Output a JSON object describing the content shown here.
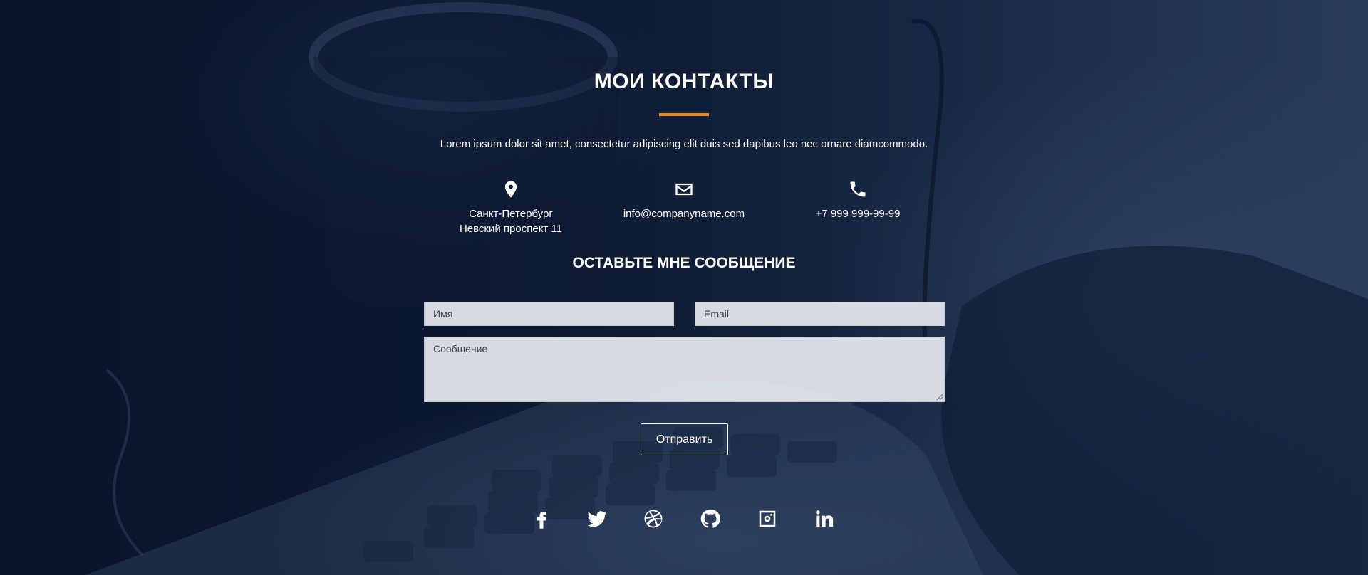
{
  "section": {
    "title": "МОИ КОНТАКТЫ",
    "subtitle": "Lorem ipsum dolor sit amet, consectetur adipiscing elit duis sed dapibus leo nec ornare diamcommodo.",
    "accent_color": "#f08a1c"
  },
  "contacts": {
    "address": {
      "icon": "map-marker-icon",
      "line1": "Санкт-Петербург",
      "line2": "Невский проспект 11"
    },
    "email": {
      "icon": "envelope-icon",
      "text": "info@companyname.com"
    },
    "phone": {
      "icon": "phone-icon",
      "text": "+7 999 999-99-99"
    }
  },
  "form": {
    "title": "ОСТАВЬТЕ МНЕ СООБЩЕНИЕ",
    "name_placeholder": "Имя",
    "email_placeholder": "Email",
    "message_placeholder": "Сообщение",
    "submit_label": "Отправить"
  },
  "social": [
    "facebook-icon",
    "twitter-icon",
    "dribbble-icon",
    "github-icon",
    "instagram-icon",
    "linkedin-icon"
  ]
}
